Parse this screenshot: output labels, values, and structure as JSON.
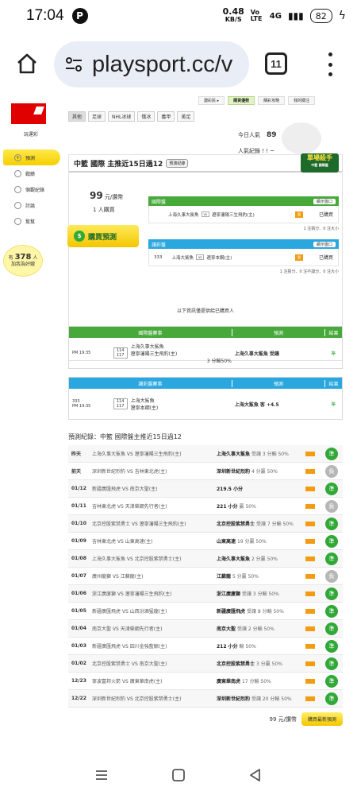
{
  "status": {
    "time": "17:04",
    "speed": "0.48",
    "speed_unit": "KB/S",
    "volte": "Vo LTE",
    "net": "4G",
    "battery": "82"
  },
  "browser": {
    "url": "playsport.cc/v",
    "tabs_count": "11"
  },
  "site": {
    "logo_label": "玩運彩",
    "nav": [
      {
        "label": "預測"
      },
      {
        "label": "戰績"
      },
      {
        "label": "個觀紀錄"
      },
      {
        "label": "討論"
      },
      {
        "label": "幫幫"
      }
    ],
    "bulb": {
      "prefix": "有",
      "count": "378",
      "suffix": "人",
      "line2": "加我為好嫂"
    },
    "topnav": [
      "讚彩民 ▸",
      "購買優勢",
      "購彩攻略",
      "我的關注"
    ],
    "categories": [
      "其他",
      "足球",
      "NHL冰球",
      "俄冰",
      "義甲",
      "美足"
    ],
    "popularity": {
      "today_label": "今日人氣",
      "today_value": "89",
      "total_label": "人氣紀錄 ! ! ~"
    },
    "main": {
      "title": "中籃 國際 主推近15日過12",
      "rec_btn": "預測紀錄",
      "killer": "單場殺手",
      "killer_sub": "中籃 國際盤",
      "price": "99",
      "price_unit": "元/讚幣",
      "buyers": "1 人購買",
      "buy_btn": "購買預測",
      "pk1": {
        "head": "國際盤",
        "show": "顯示盤口",
        "match": "上海久事大鯊魚",
        "vs": "vs",
        "opp": "遼寧瀋陽三生飛豹(主)",
        "status": "已購買",
        "foot": "1 注猜分、0 注大小"
      },
      "pk2": {
        "head": "讓彩盤",
        "show": "顯示盤口",
        "num": "333",
        "match": "上海大鯊魚",
        "vs": "vs",
        "opp": "遼寧本鋼(主)",
        "status": "已購買",
        "foot": "1 注猜分、0 注不讓分、0 注大小"
      }
    },
    "list_caption": "以下資訊僅提供給已購買人",
    "table1": {
      "h1": "國際盤賽事",
      "h2": "預測",
      "h3": "結果",
      "time": "PM 19:35",
      "n1": "114",
      "n2": "117",
      "t1": "上海久事大鯊魚",
      "t2": "遼寧瀋陽三生飛豹(主)",
      "line": "3 分輸50%",
      "pick": "上海久事大鯊魚 受讓",
      "res": "準"
    },
    "table2": {
      "h1": "讓彩盤賽事",
      "h2": "預測",
      "h3": "結果",
      "num": "333",
      "time": "PM 19:35",
      "n1": "114",
      "n2": "117",
      "t1": "上海大鯊魚",
      "t2": "遼寧本鋼(主)",
      "pick": "上海大鯊魚 客 +4.5",
      "res": "準"
    },
    "history_title": "預測紀錄：中籃 國際盤主推近15日過12",
    "history": [
      {
        "date": "昨天",
        "match": "上海久事大鯊魚 VS 遼寧瀋陽三生飛豹(主)",
        "pick": "上海久事大鯊魚",
        "detail": "受讓 3 分輸 50%",
        "res": "準",
        "win": true
      },
      {
        "date": "前天",
        "match": "深圳新世紀烈豹 VS 吉林東北虎(主)",
        "pick": "深圳新世紀烈豹",
        "detail": "4 分贏 50%",
        "res": "負",
        "win": false
      },
      {
        "date": "01/12",
        "match": "新疆廣匯飛虎 VS 南京大聖(主)",
        "pick": "219.5 小分",
        "detail": "",
        "res": "準",
        "win": true
      },
      {
        "date": "01/11",
        "match": "吉林東北虎 VS 天津榮鋼先行者(主)",
        "pick": "221 小分",
        "detail": "贏 50%",
        "res": "負",
        "win": false
      },
      {
        "date": "01/10",
        "match": "北京控股紫禁勇士 VS 遼寧瀋陽三生飛豹(主)",
        "pick": "北京控股紫禁勇士",
        "detail": "受讓 7 分輸 50%",
        "res": "準",
        "win": true
      },
      {
        "date": "01/09",
        "match": "吉林東北虎 VS 山東高速(主)",
        "pick": "山東高速",
        "detail": "19 分贏 50%",
        "res": "準",
        "win": true
      },
      {
        "date": "01/08",
        "match": "上海久事大鯊魚 VS 北京控股紫禁勇士(主)",
        "pick": "上海久事大鯊魚",
        "detail": "2 分贏 50%",
        "res": "準",
        "win": true
      },
      {
        "date": "01/07",
        "match": "廣州龍獅 VS 江蘇龍(主)",
        "pick": "江蘇龍",
        "detail": "5 分贏 50%",
        "res": "負",
        "win": false
      },
      {
        "date": "01/06",
        "match": "浙江廣廈獅 VS 遼寧瀋陽三生飛豹(主)",
        "pick": "浙江廣廈獅",
        "detail": "受讓 3 分輸 50%",
        "res": "準",
        "win": true
      },
      {
        "date": "01/05",
        "match": "新疆廣匯飛虎 VS 山西汾酒猛龍(主)",
        "pick": "新疆廣匯飛虎",
        "detail": "受讓 8 分輸 50%",
        "res": "準",
        "win": true
      },
      {
        "date": "01/04",
        "match": "南京大聖 VS 天津榮鋼先行者(主)",
        "pick": "南京大聖",
        "detail": "受讓 2 分輸 50%",
        "res": "準",
        "win": true
      },
      {
        "date": "01/03",
        "match": "新疆廣匯飛虎 VS 四川金強藍鯨(主)",
        "pick": "212 小分",
        "detail": "輸 50%",
        "res": "準",
        "win": true
      },
      {
        "date": "01/02",
        "match": "北京控股紫禁勇士 VS 南京大聖(主)",
        "pick": "北京控股紫禁勇士",
        "detail": "3 分贏 50%",
        "res": "準",
        "win": true
      },
      {
        "date": "12/23",
        "match": "寧波富邦火箭 VS 廣東華南虎(主)",
        "pick": "廣東華南虎",
        "detail": "17 分輸 50%",
        "res": "準",
        "win": true
      },
      {
        "date": "12/22",
        "match": "深圳新世紀烈豹 VS 北京控股紫禁勇士(主)",
        "pick": "深圳新世紀烈豹",
        "detail": "受讓 20 分輸 50%",
        "res": "準",
        "win": true
      }
    ],
    "footer": {
      "price": "99 元/讚幣",
      "btn": "購買最新預測"
    }
  },
  "colors": {
    "green_header": "#48a93b",
    "blue_header": "#2aa7df",
    "win": "#31a837",
    "lose": "#b7b7b7"
  }
}
